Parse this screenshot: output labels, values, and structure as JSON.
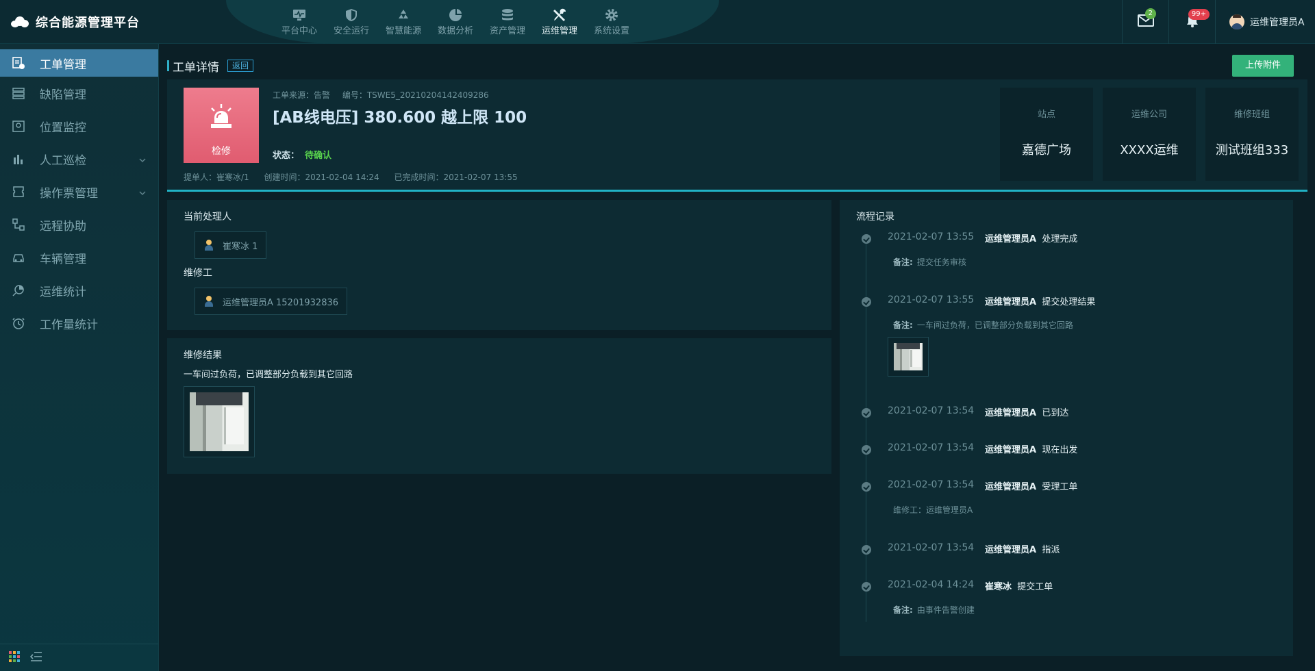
{
  "app": {
    "title": "综合能源管理平台"
  },
  "topnav": [
    {
      "label": "平台中心",
      "icon": "monitor-icon"
    },
    {
      "label": "安全运行",
      "icon": "shield-icon"
    },
    {
      "label": "智慧能源",
      "icon": "recycle-icon"
    },
    {
      "label": "数据分析",
      "icon": "pie-chart-icon"
    },
    {
      "label": "资产管理",
      "icon": "database-icon"
    },
    {
      "label": "运维管理",
      "icon": "wrench-icon",
      "active": true
    },
    {
      "label": "系统设置",
      "icon": "gear-icon"
    }
  ],
  "header": {
    "mail_count": "2",
    "notify_count": "99+",
    "user_name": "运维管理员A"
  },
  "sidebar": {
    "items": [
      {
        "label": "工单管理",
        "icon": "workorder-icon",
        "active": true
      },
      {
        "label": "缺陷管理",
        "icon": "defect-icon"
      },
      {
        "label": "位置监控",
        "icon": "map-pin-icon"
      },
      {
        "label": "人工巡检",
        "icon": "bar-chart-icon",
        "expandable": true
      },
      {
        "label": "操作票管理",
        "icon": "ticket-icon",
        "expandable": true
      },
      {
        "label": "远程协助",
        "icon": "flow-icon"
      },
      {
        "label": "车辆管理",
        "icon": "car-icon"
      },
      {
        "label": "运维统计",
        "icon": "stats-icon"
      },
      {
        "label": "工作量统计",
        "icon": "clock-icon"
      }
    ]
  },
  "page": {
    "title": "工单详情",
    "back_label": "返回",
    "upload_label": "上传附件"
  },
  "detail": {
    "type_label": "检修",
    "source": "工单来源：告警",
    "code": "编号：TSWE5_20210204142409286",
    "title": "[AB线电压] 380.600 越上限 100",
    "status_label": "状态：",
    "status_value": "待确认",
    "submitter": "提单人：崔寒冰/1",
    "created": "创建时间：2021-02-04 14:24",
    "completed": "已完成时间：2021-02-07 13:55",
    "info": [
      {
        "label": "站点",
        "value": "嘉德广场"
      },
      {
        "label": "运维公司",
        "value": "XXXX运维"
      },
      {
        "label": "维修班组",
        "value": "测试班组333"
      }
    ]
  },
  "handlers": {
    "current_title": "当前处理人",
    "current_person": "崔寒冰 1",
    "repair_title": "维修工",
    "repair_person": "运维管理员A 15201932836"
  },
  "result": {
    "title": "维修结果",
    "text": "一车间过负荷，已调整部分负载到其它回路"
  },
  "flow": {
    "title": "流程记录",
    "records": [
      {
        "time": "2021-02-07 13:55",
        "actor": "运维管理员A",
        "action": "处理完成",
        "note_key": "备注:",
        "note": "提交任务审核"
      },
      {
        "time": "2021-02-07 13:55",
        "actor": "运维管理员A",
        "action": "提交处理结果",
        "note_key": "备注:",
        "note": "一车间过负荷，已调整部分负载到其它回路"
      },
      {
        "time": "2021-02-07 13:54",
        "actor": "运维管理员A",
        "action": "已到达"
      },
      {
        "time": "2021-02-07 13:54",
        "actor": "运维管理员A",
        "action": "现在出发"
      },
      {
        "time": "2021-02-07 13:54",
        "actor": "运维管理员A",
        "action": "受理工单",
        "note_key": "",
        "note": "维修工：运维管理员A"
      },
      {
        "time": "2021-02-07 13:54",
        "actor": "运维管理员A",
        "action": "指派"
      },
      {
        "time": "2021-02-04 14:24",
        "actor": "崔寒冰",
        "action": "提交工单",
        "note_key": "备注:",
        "note": "由事件告警创建"
      }
    ]
  }
}
